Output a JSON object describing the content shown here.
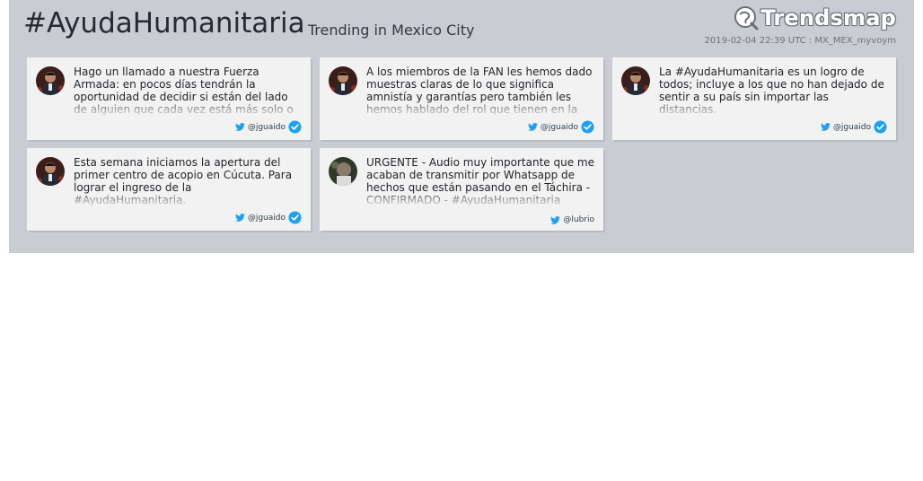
{
  "header": {
    "title": "#AyudaHumanitaria",
    "subtitle": "- Trending in Mexico City",
    "brand": "Trendsmap",
    "meta": "2019-02-04 22:39 UTC : MX_MEX_myvoym"
  },
  "cards": [
    {
      "text": "Hago un llamado a nuestra Fuerza Armada: en pocos días tendrán la oportunidad de decidir si están del lado de alguien que cada vez está más solo o",
      "handle": "@jguaido",
      "verified": true,
      "avatar": "avatar-jguaido"
    },
    {
      "text": "A los miembros de la FAN les hemos dado muestras claras de lo que significa amnistía y garantías pero también les hemos hablado del rol que tienen en la",
      "handle": "@jguaido",
      "verified": true,
      "avatar": "avatar-jguaido"
    },
    {
      "text": "La #AyudaHumanitaria es un logro de todos; incluye a los que no han dejado de sentir a su país sin importar las distancias.",
      "handle": "@jguaido",
      "verified": true,
      "avatar": "avatar-jguaido"
    },
    {
      "text": "Esta semana iniciamos la apertura del primer centro de acopio en Cúcuta. Para lograr el ingreso de la #AyudaHumanitaria.",
      "handle": "@jguaido",
      "verified": true,
      "avatar": "avatar-jguaido"
    },
    {
      "text": "URGENTE - Audio muy importante que me acaban de transmitir por Whatsapp de hechos que están pasando en el Táchira - CONFIRMADO - #AyudaHumanitaria",
      "handle": "@lubrio",
      "verified": false,
      "avatar": "avatar-lubrio"
    }
  ],
  "colors": {
    "panel": "#c9ccd3",
    "card": "#f2f2f2",
    "twitter_blue": "#1da1f2",
    "verified_blue": "#1da1f2"
  },
  "icons": [
    "trendsmap-logo-icon",
    "twitter-bird-icon",
    "verified-badge-icon"
  ]
}
